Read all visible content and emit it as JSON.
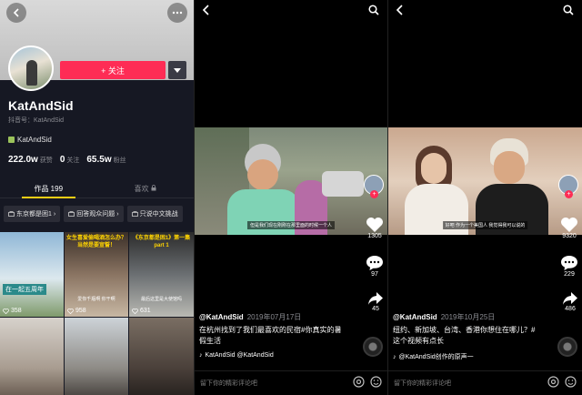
{
  "profile": {
    "name": "KatAndSid",
    "douyin_id": "抖音号：KatAndSid",
    "follow_label": "+ 关注",
    "tag": "KatAndSid",
    "stats": [
      {
        "value": "222.0w",
        "label": "获赞"
      },
      {
        "value": "0",
        "label": "关注"
      },
      {
        "value": "65.5w",
        "label": "粉丝"
      }
    ],
    "tabs": [
      {
        "label": "作品 199",
        "active": true
      },
      {
        "label": "喜欢",
        "active": false
      }
    ],
    "chips": [
      "东京都是困1",
      "回答观众问题",
      "只说中文挑战"
    ],
    "grid": [
      {
        "likes": "358",
        "caption": "在一起五周年",
        "type": "box"
      },
      {
        "likes": "958",
        "caption": "女生喜爱偷喝酒怎么办？当然是要宣誓！",
        "caption2": "爱你千瓶啊 你干啊",
        "type": "yellow"
      },
      {
        "likes": "631",
        "caption": "《东京都是困1》第一集 part 1",
        "caption2": "最后这里是大使馆吗",
        "type": "yellow"
      },
      {
        "likes": "",
        "caption": "",
        "type": "none"
      },
      {
        "likes": "",
        "caption": "",
        "type": "none"
      },
      {
        "likes": "",
        "caption": "",
        "type": "none"
      }
    ]
  },
  "video1": {
    "subtitle": "但是我们现在刚刚在那里面的时候一个人",
    "likes": "1305",
    "comments": "97",
    "shares": "45",
    "author": "@KatAndSid",
    "date": "2019年07月17日",
    "description": "在杭州找到了我们最喜欢的民宿#你真实的暑假生活",
    "music": "KatAndSid    @KatAndSid",
    "comment_placeholder": "留下你的精彩评论吧"
  },
  "video2": {
    "subtitle": "好吧 作为一个美国人 我觉得我可以说的",
    "likes": "9320",
    "comments": "229",
    "shares": "486",
    "author": "@KatAndSid",
    "date": "2019年10月25日",
    "description": "纽约、新加坡、台湾、香港你想住在哪儿？#这个视频有点长",
    "music": "@KatAndSid创作的原声一",
    "comment_placeholder": "留下你的精彩评论吧"
  },
  "colors": {
    "accent": "#fe2c55",
    "tab_underline": "#face15",
    "profile_bg": "#161823"
  }
}
